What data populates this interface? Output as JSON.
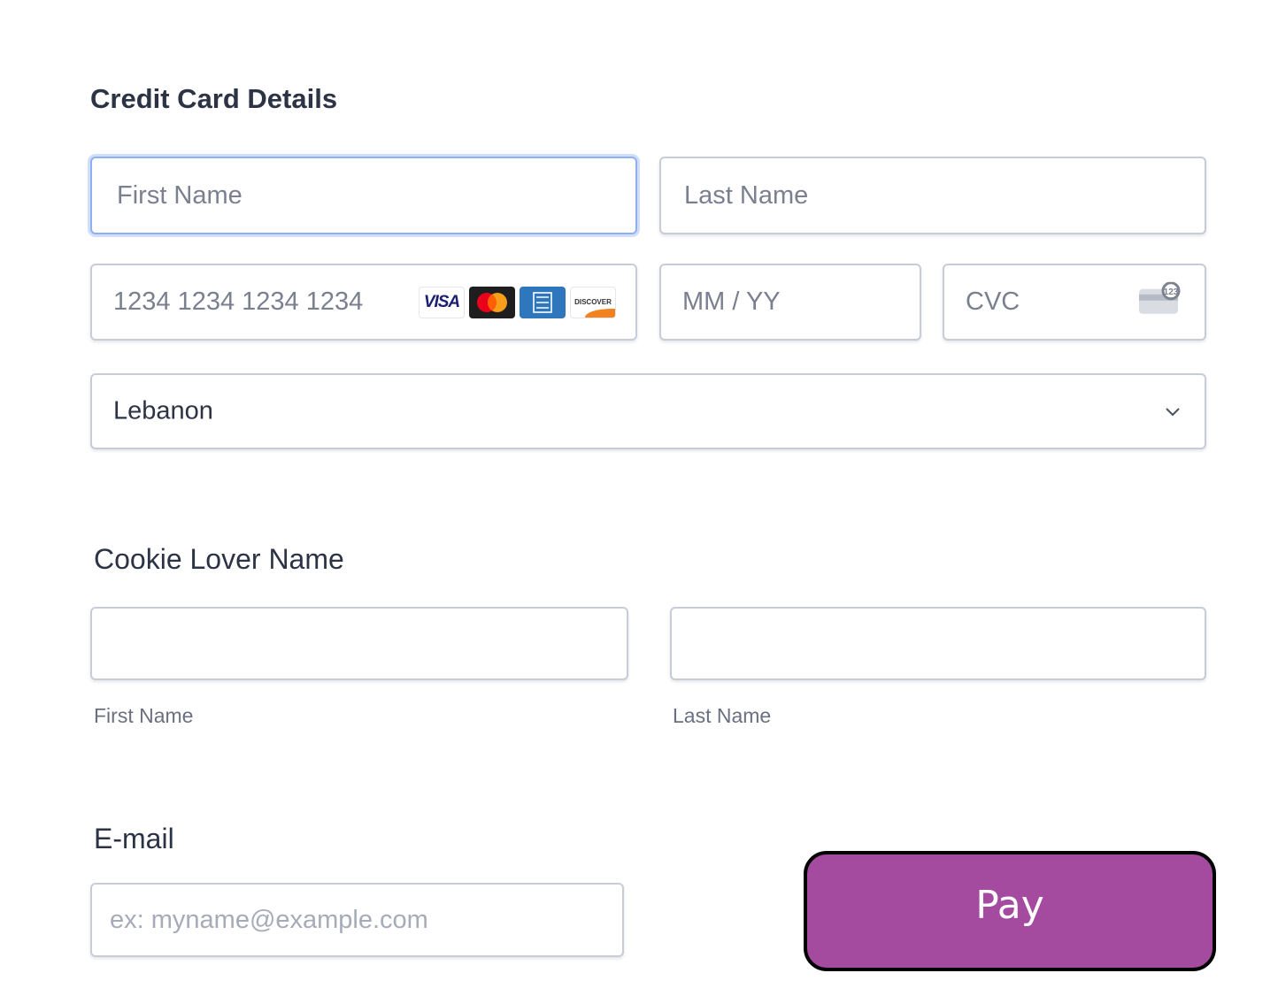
{
  "credit_card": {
    "title": "Credit Card Details",
    "first_name_placeholder": "First Name",
    "last_name_placeholder": "Last Name",
    "card_number_placeholder": "1234 1234 1234 1234",
    "expiry_placeholder": "MM / YY",
    "cvc_placeholder": "CVC",
    "card_brands": [
      "visa",
      "mastercard",
      "amex",
      "discover"
    ],
    "visa_text": "VISA",
    "discover_text": "DISCOVER",
    "country_value": "Lebanon"
  },
  "cookie_lover": {
    "title": "Cookie Lover Name",
    "first_name_value": "",
    "last_name_value": "",
    "first_name_label": "First Name",
    "last_name_label": "Last Name"
  },
  "email": {
    "title": "E-mail",
    "placeholder": "ex: myname@example.com",
    "value": ""
  },
  "pay_button": {
    "label": "Pay"
  },
  "colors": {
    "pay_button_bg": "#a44a9f",
    "pay_button_border": "#000000",
    "focus_border": "#8fb0f0",
    "field_border": "#c8ccd8",
    "heading_text": "#2c3345"
  },
  "icons": {
    "country_dropdown": "chevron-down-icon",
    "cvc": "credit-card-back-icon"
  }
}
